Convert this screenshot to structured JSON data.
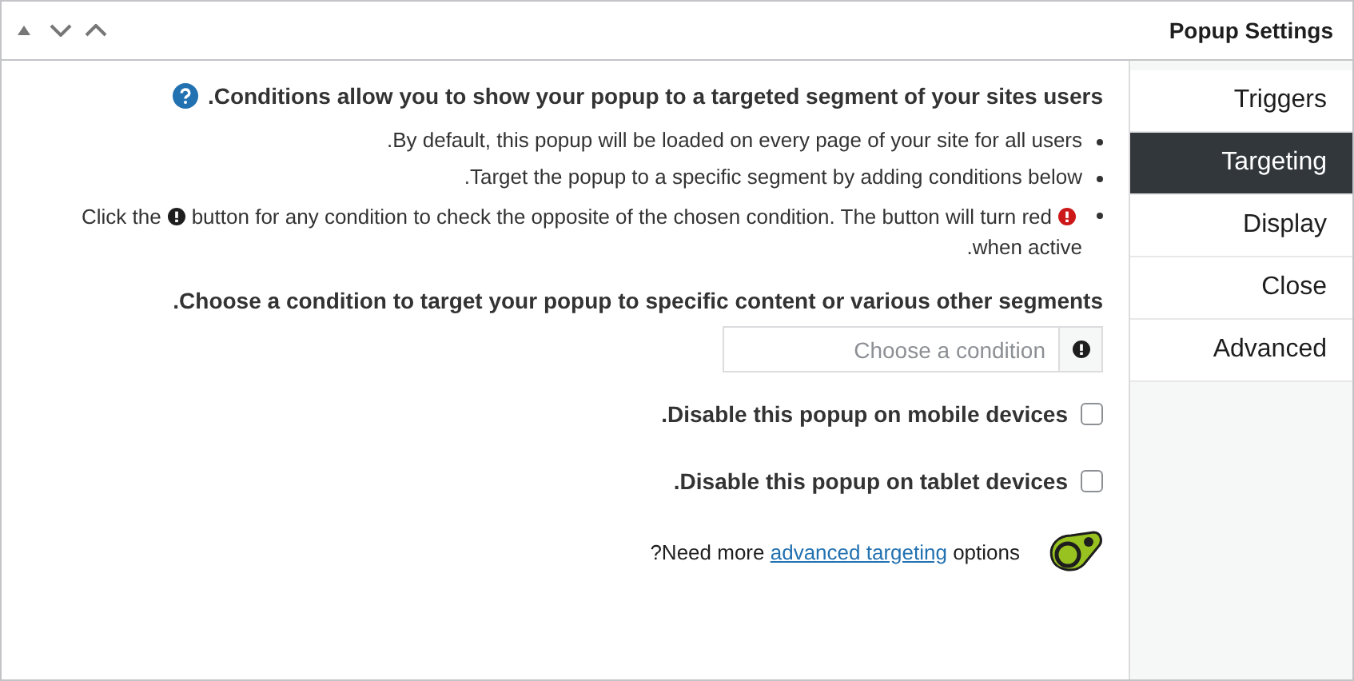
{
  "header": {
    "title": "Popup Settings"
  },
  "tabs": [
    {
      "label": "Triggers",
      "selected": false
    },
    {
      "label": "Targeting",
      "selected": true
    },
    {
      "label": "Display",
      "selected": false
    },
    {
      "label": "Close",
      "selected": false
    },
    {
      "label": "Advanced",
      "selected": false
    }
  ],
  "intro": ".Conditions allow you to show your popup to a targeted segment of your sites users",
  "bullets": [
    {
      "kind": "text",
      "text": ".By default, this popup will be loaded on every page of your site for all users"
    },
    {
      "kind": "text",
      "text": ".Target the popup to a specific segment by adding conditions below"
    },
    {
      "kind": "icons",
      "before": "Click the",
      "middle": "button for any condition to check the opposite of the chosen condition. The button will turn red",
      "after": ".when active"
    }
  ],
  "condition_heading": ".Choose a condition to target your popup to specific content or various other segments",
  "condition_select": {
    "placeholder": "Choose a condition"
  },
  "options": [
    {
      "label": ".Disable this popup on mobile devices",
      "checked": false
    },
    {
      "label": ".Disable this popup on tablet devices",
      "checked": false
    }
  ],
  "upsell": {
    "before": "?Need more",
    "link": "advanced targeting",
    "after": "options"
  }
}
